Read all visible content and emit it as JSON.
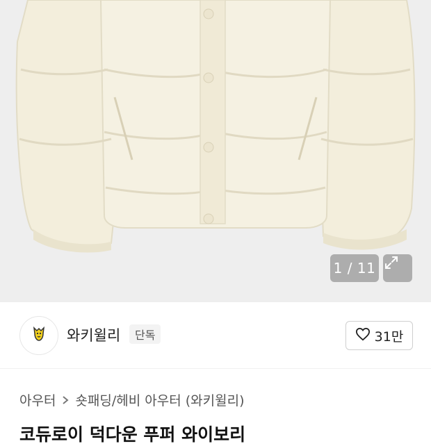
{
  "gallery": {
    "counter": "1 / 11",
    "expand_icon": "expand-arrows-icon"
  },
  "brand": {
    "name": "와키윌리",
    "badge": "단독",
    "logo_icon": "duck-mascot-icon",
    "like_count": "31만",
    "like_icon": "heart-outline-icon"
  },
  "breadcrumb": {
    "items": [
      "아우터",
      "숏패딩/헤비 아우터 (와키윌리)"
    ],
    "separator_icon": "chevron-right-icon"
  },
  "product": {
    "title": "코듀로이 덕다운 푸퍼 와이보리"
  },
  "colors": {
    "jacket": "#f3eedc",
    "jacket_shadow": "#e2dcc6",
    "background": "#eeeeee",
    "logo_yellow": "#f4d21c"
  }
}
